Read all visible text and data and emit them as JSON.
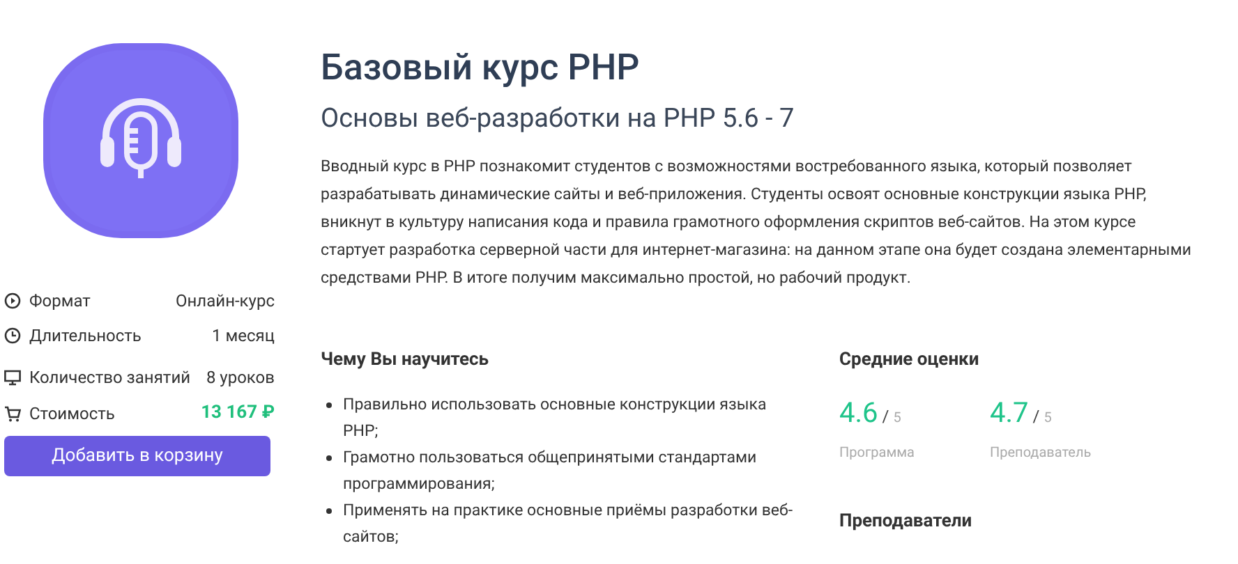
{
  "course": {
    "title": "Базовый курс PHP",
    "subtitle": "Основы веб-разработки на PHP 5.6 - 7",
    "description": "Вводный курс в PHP познакомит студентов с возможностями востребованного языка, который позволяет разрабатывать динамические сайты и веб-приложения. Студенты освоят основные конструкции языка PHP, вникнут в культуру написания кода и правила грамотного оформления скриптов веб-сайтов. На этом курсе стартует разработка серверной части для интернет-магазина: на данном этапе она будет создана элементарными средствами PHP. В итоге получим максимально простой, но рабочий продукт."
  },
  "details": [
    {
      "kind": "play",
      "label": "Формат",
      "value": "Онлайн-курс",
      "accent": false
    },
    {
      "kind": "clock",
      "label": "Длительность",
      "value": "1 месяц",
      "accent": false
    },
    {
      "kind": "monitor",
      "label": "Количество занятий",
      "value": "8 уроков",
      "accent": false
    },
    {
      "kind": "cart",
      "label": "Стоимость",
      "value": "13 167 ₽",
      "accent": true
    }
  ],
  "cart_button": "Добавить в корзину",
  "learn": {
    "heading": "Чему Вы научитесь",
    "items": [
      "Правильно использовать основные конструкции языка PHP;",
      "Грамотно пользоваться общепринятыми стандартами программирования;",
      "Применять на практике основные приёмы разработки веб-сайтов;"
    ]
  },
  "ratings": {
    "heading": "Средние оценки",
    "items": [
      {
        "score": "4.6",
        "separator": "/",
        "max": "5",
        "label": "Программа"
      },
      {
        "score": "4.7",
        "separator": "/",
        "max": "5",
        "label": "Преподаватель"
      }
    ]
  },
  "teachers_heading": "Преподаватели"
}
